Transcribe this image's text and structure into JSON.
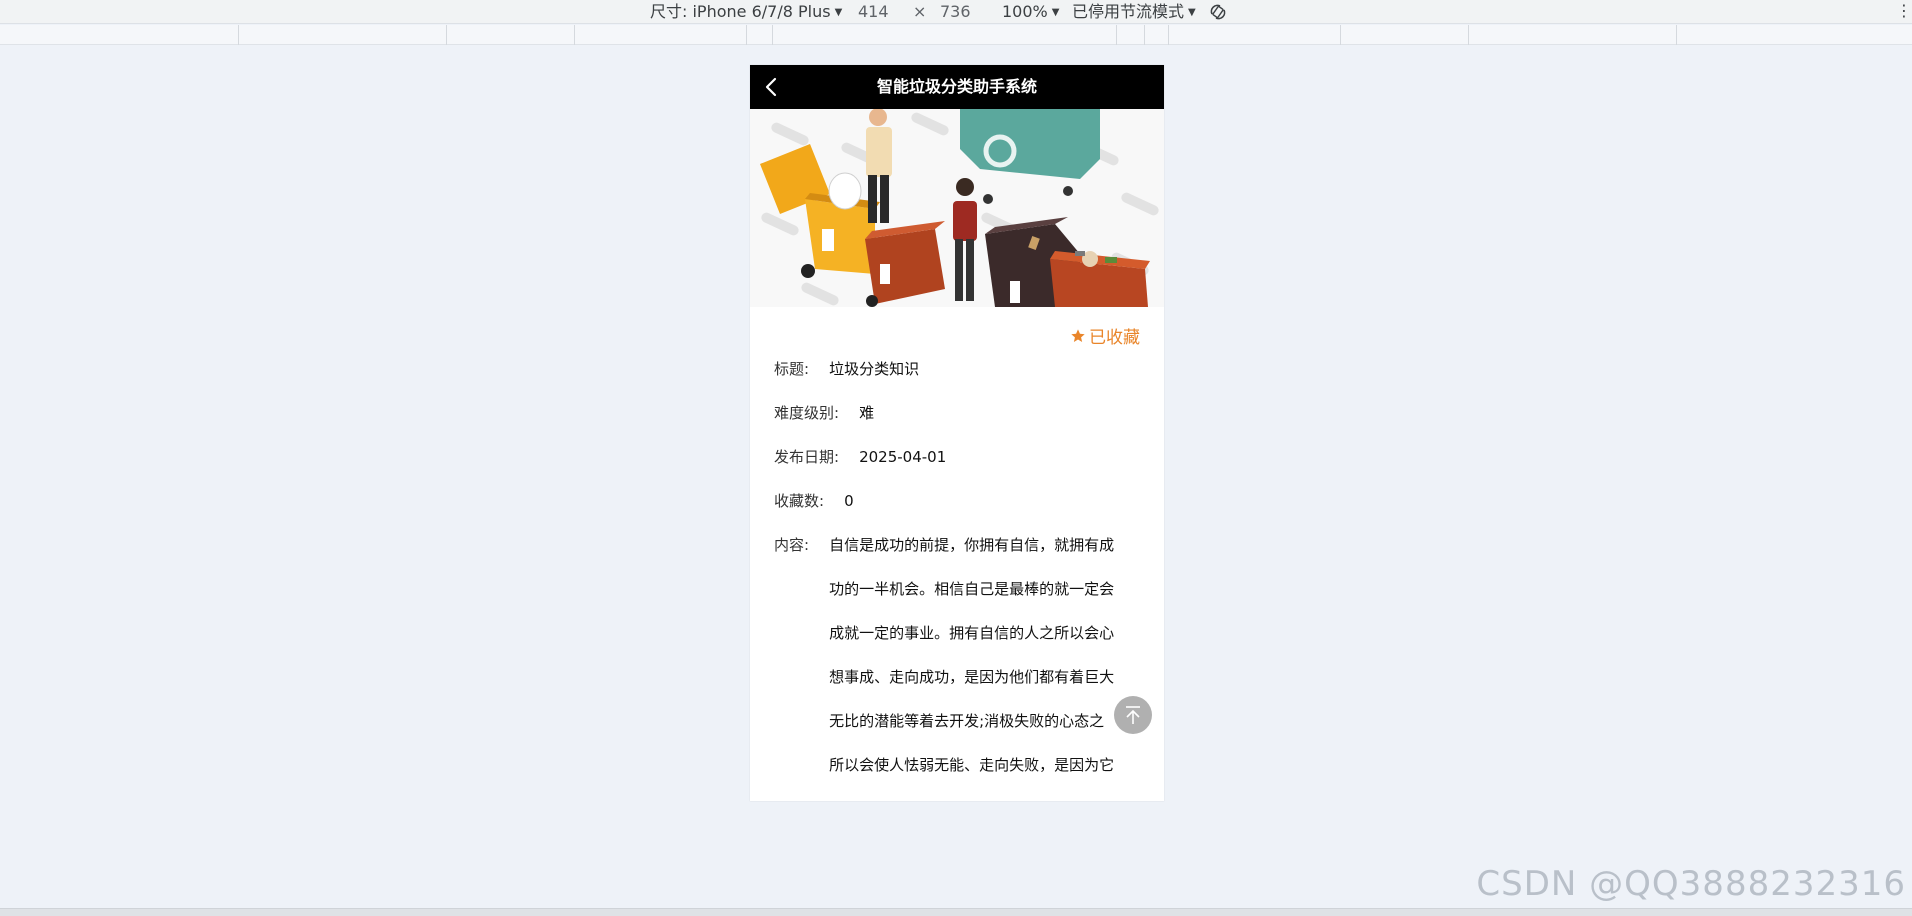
{
  "devtools": {
    "device_label": "尺寸: iPhone 6/7/8 Plus",
    "width": "414",
    "times": "×",
    "height": "736",
    "zoom": "100%",
    "throttle": "已停用节流模式"
  },
  "app": {
    "title": "智能垃圾分类助手系统"
  },
  "favorite": {
    "label": "已收藏",
    "color": "#e9852a"
  },
  "detail": {
    "title_label": "标题:",
    "title_value": "垃圾分类知识",
    "difficulty_label": "难度级别:",
    "difficulty_value": "难",
    "date_label": "发布日期:",
    "date_value": "2025-04-01",
    "fav_count_label": "收藏数:",
    "fav_count_value": "0",
    "content_label": "内容:",
    "content_lines": [
      "自信是成功的前提，你拥有自信，就拥有成",
      "功的一半机会。相信自己是最棒的就一定会",
      "成就一定的事业。拥有自信的人之所以会心",
      "想事成、走向成功，是因为他们都有着巨大",
      "无比的潜能等着去开发;消极失败的心态之",
      "所以会使人怯弱无能、走向失败，是因为它"
    ]
  },
  "watermark": "CSDN @QQ3888232316"
}
